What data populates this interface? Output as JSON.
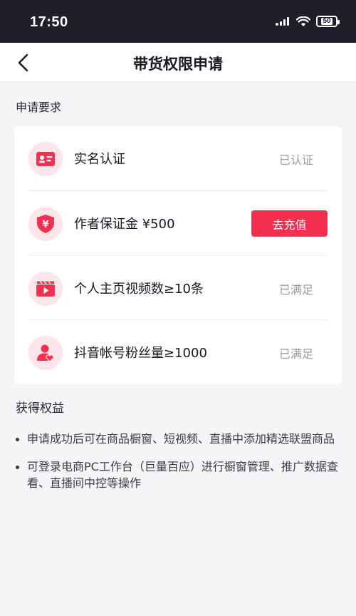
{
  "status_bar": {
    "time": "17:50",
    "battery": "50",
    "icons": [
      "signal-icon",
      "wifi-icon",
      "battery-icon"
    ]
  },
  "nav": {
    "back_icon": "chevron-left-icon",
    "title": "带货权限申请"
  },
  "requirements": {
    "label": "申请要求",
    "items": [
      {
        "icon": "id-card-icon",
        "label": "实名认证",
        "status": "已认证"
      },
      {
        "icon": "yuan-shield-icon",
        "label": "作者保证金 ¥500",
        "action": "去充值"
      },
      {
        "icon": "video-clapper-icon",
        "label": "个人主页视频数≥10条",
        "status": "已满足"
      },
      {
        "icon": "person-heart-icon",
        "label": "抖音帐号粉丝量≥1000",
        "status": "已满足"
      }
    ]
  },
  "benefits": {
    "label": "获得权益",
    "items": [
      "申请成功后可在商品橱窗、短视频、直播中添加精选联盟商品",
      "可登录电商PC工作台（巨量百应）进行橱窗管理、推广数据查看、直播间中控等操作"
    ]
  },
  "colors": {
    "accent": "#f2304f",
    "icon_bg": "#fce6ea",
    "status_bar_bg": "#1f1f2b"
  }
}
